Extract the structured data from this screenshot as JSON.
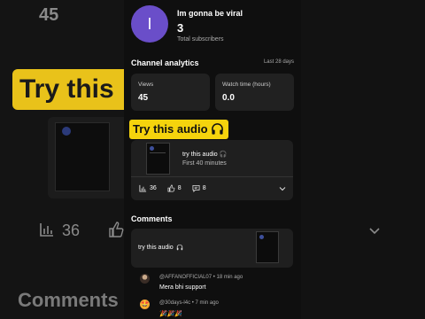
{
  "channel": {
    "avatar_letter": "I",
    "avatar_color": "#6a4ec9",
    "name": "Im gonna be viral",
    "subscribers": "3",
    "subscribers_label": "Total subscribers"
  },
  "analytics": {
    "title": "Channel analytics",
    "range": "Last 28 days",
    "metrics": [
      {
        "label": "Views",
        "value": "45"
      },
      {
        "label": "Watch time (hours)",
        "value": "0.0"
      }
    ]
  },
  "banner": {
    "text": "Try this audio",
    "icon": "headphones-icon",
    "color": "#f5d30d"
  },
  "video": {
    "title": "try this audio 🎧",
    "published": "First 40 minutes",
    "stats": {
      "views": "36",
      "likes": "8",
      "comments": "8"
    }
  },
  "comments": {
    "title": "Comments",
    "video_title": "try this audio",
    "items": [
      {
        "meta": "@AFFANOFFICIAL07 • 18 min ago",
        "text": "Mera bhi support"
      },
      {
        "meta": "@30days-l4c • 7 min ago",
        "text": "🎉🎉🎉"
      }
    ]
  },
  "background": {
    "top_number": "45",
    "banner_text": "Try this",
    "views_count": "36",
    "comments_text": "Comments"
  }
}
